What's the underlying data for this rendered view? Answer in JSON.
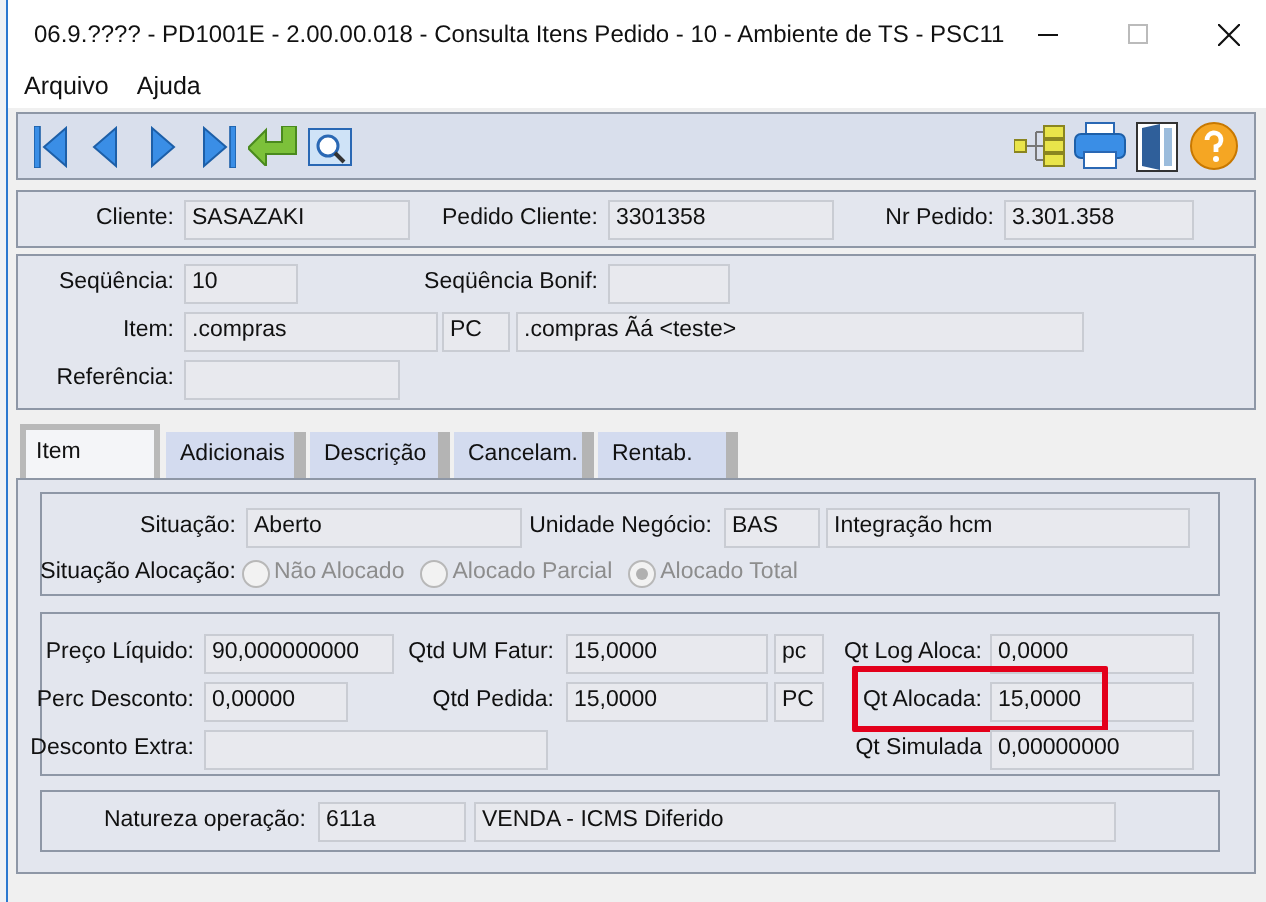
{
  "window": {
    "title": "06.9.???? - PD1001E - 2.00.00.018 - Consulta Itens Pedido - 10 - Ambiente de TS - PSC11"
  },
  "menu": [
    "Arquivo",
    "Ajuda"
  ],
  "header_fields": [
    {
      "label": "Cliente:",
      "value": "SASAZAKI"
    },
    {
      "label": "Pedido Cliente:",
      "value": "3301358"
    },
    {
      "label": "Nr Pedido:",
      "value": "3.301.358"
    }
  ],
  "item_panel": {
    "sequencia": {
      "label": "Seqüência:",
      "value": "10"
    },
    "sequencia_bonif": {
      "label": "Seqüência Bonif:"
    },
    "item": {
      "label": "Item:",
      "values": [
        ".compras",
        "PC",
        ".compras Ãá <teste>"
      ]
    },
    "referencia": {
      "label": "Referência:"
    }
  },
  "tabs": [
    {
      "label": "Item",
      "selected": true
    },
    {
      "label": "Adicionais",
      "selected": false
    },
    {
      "label": "Descrição",
      "selected": false
    },
    {
      "label": "Cancelam.",
      "selected": false
    },
    {
      "label": "Rentab.",
      "selected": false
    }
  ],
  "situacao": {
    "label": "Situação:",
    "value": "Aberto"
  },
  "unidade_negocio": {
    "label": "Unidade Negócio:",
    "values": [
      "BAS",
      "Integração hcm"
    ]
  },
  "situacao_alocacao": {
    "label": "Situação Alocação:",
    "options": [
      {
        "label": "Não Alocado",
        "selected": false,
        "disabled": true
      },
      {
        "label": "Alocado Parcial",
        "selected": false,
        "disabled": true
      },
      {
        "label": "Alocado Total",
        "selected": true,
        "disabled": true
      }
    ]
  },
  "quantities": [
    {
      "label": "Preço Líquido:",
      "value": "90,000000000",
      "highlighted": false
    },
    {
      "label": "Qtd UM Fatur:",
      "value": "15,0000",
      "unit": "pc",
      "highlighted": false
    },
    {
      "label": "Qt Log Aloca:",
      "value": "0,0000",
      "highlighted": false
    },
    {
      "label": "Perc Desconto:",
      "value": "0,00000",
      "highlighted": false
    },
    {
      "label": "Qtd Pedida:",
      "value": "15,0000",
      "unit": "PC",
      "highlighted": false
    },
    {
      "label": "Qt Alocada:",
      "value": "15,0000",
      "highlighted": true
    },
    {
      "label": "Desconto Extra:",
      "highlighted": false
    },
    {
      "label": "Qt Simulada",
      "value": "0,00000000",
      "highlighted": false
    }
  ],
  "natureza_operacao": {
    "label": "Natureza operação:",
    "values": [
      "611a",
      "VENDA - ICMS Diferido"
    ]
  }
}
